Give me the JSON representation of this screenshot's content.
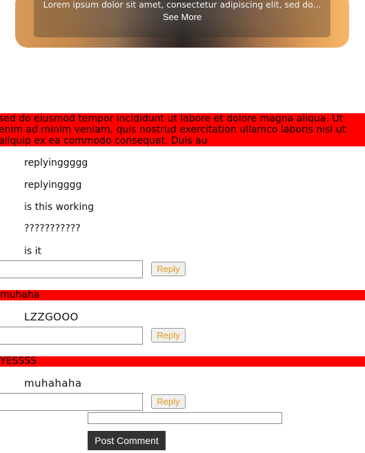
{
  "hero": {
    "caption": "Lorem ipsum dolor sit amet, consectetur adipiscing elit, sed do...",
    "see_more": "See More"
  },
  "post": {
    "lines": [
      "sed do eiusmod tempor incididunt ut labore et dolore magna aliqua. Ut",
      "enim ad minim veniam, quis nostrud exercitation ullamco laboris nisi ut",
      "aliquip ex ea commodo consequat. Duis au"
    ]
  },
  "thread1": {
    "replies": [
      "replyinggggg",
      "replyingggg",
      "is this working",
      "???????????",
      "is it"
    ],
    "reply_button": "Reply"
  },
  "comment2": {
    "text": "muhaha",
    "replies": [
      "LZZGOOO"
    ],
    "reply_button": "Reply"
  },
  "comment3": {
    "text": "YESSSS",
    "replies": [
      "muhahaha"
    ],
    "reply_button": "Reply"
  },
  "composer": {
    "post_button": "Post Comment"
  }
}
